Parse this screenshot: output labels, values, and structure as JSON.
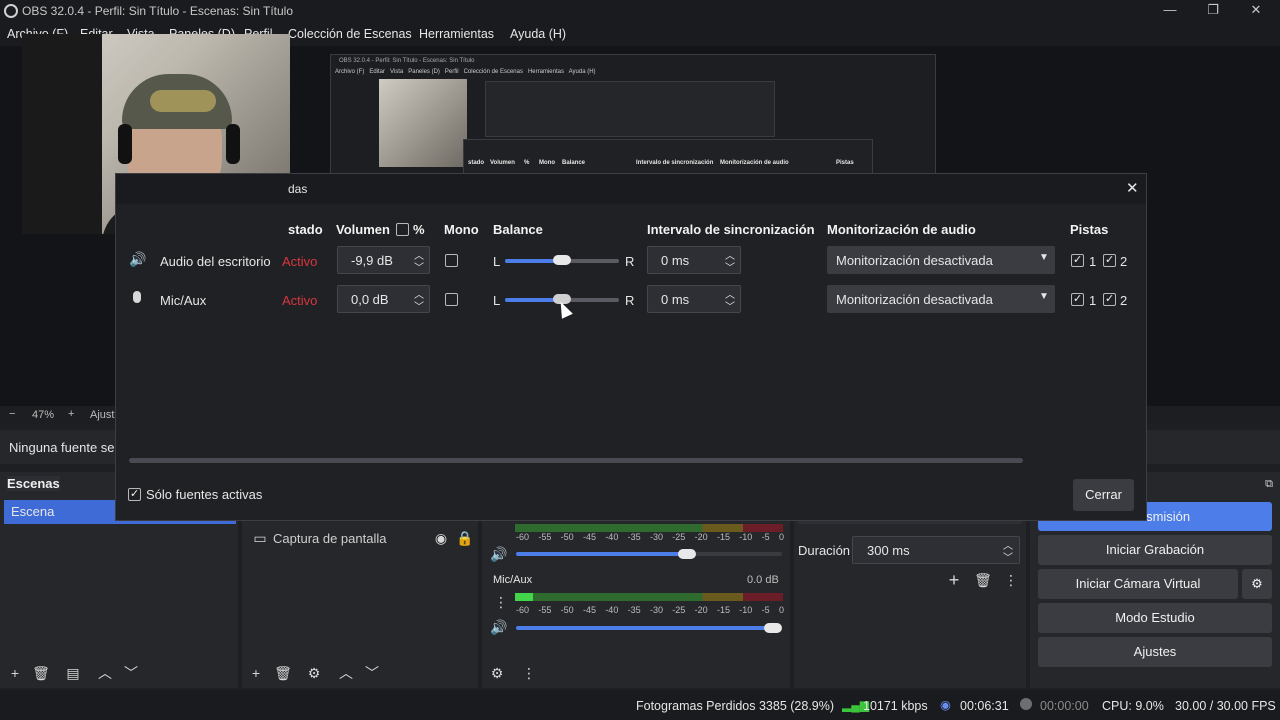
{
  "window": {
    "title": "OBS 32.0.4 - Perfil: Sin Título - Escenas: Sin Título"
  },
  "menu": [
    "Archivo (F)",
    "Editar",
    "Vista",
    "Paneles (D)",
    "Perfil",
    "Colección de Escenas",
    "Herramientas",
    "Ayuda (H)"
  ],
  "preview": {
    "zoom_minus": "−",
    "zoom_value": "47%",
    "zoom_plus": "+",
    "zoom_fit": "Ajust",
    "nested_title": "OBS 32.0.4 - Perfil: Sin Título - Escenas: Sin Título",
    "nested_menu": "Archivo (F)   Editar   Vista   Paneles (D)   Perfil   Colección de Escenas   Herramientas   Ayuda (H)",
    "nested_cols": [
      "stado",
      "Volumen",
      "%",
      "Mono",
      "Balance",
      "Intervalo de sincronización",
      "Monitorización de audio",
      "Pistas"
    ]
  },
  "source_bar": {
    "text": "Ninguna fuente sel"
  },
  "dialog": {
    "title": "das",
    "headers": {
      "estado": "stado",
      "volumen": "Volumen",
      "percent": "%",
      "mono": "Mono",
      "balance": "Balance",
      "sync": "Intervalo de sincronización",
      "monitor": "Monitorización de audio",
      "tracks": "Pistas"
    },
    "rows": [
      {
        "icon": "speaker-icon",
        "name": "Audio del escritorio",
        "status": "Activo",
        "volume": "-9,9 dB",
        "mono": false,
        "bal_l": "L",
        "bal_r": "R",
        "balance": 0.5,
        "sync": "0 ms",
        "monitor": "Monitorización desactivada",
        "t1": "1",
        "t2": "2"
      },
      {
        "icon": "mic-icon",
        "name": "Mic/Aux",
        "status": "Activo",
        "volume": "0,0 dB",
        "mono": false,
        "bal_l": "L",
        "bal_r": "R",
        "balance": 0.5,
        "sync": "0 ms",
        "monitor": "Monitorización desactivada",
        "t1": "1",
        "t2": "2"
      }
    ],
    "only_active_label": "Sólo fuentes activas",
    "close_label": "Cerrar"
  },
  "scenes": {
    "title": "Escenas",
    "items": [
      "Escena"
    ]
  },
  "sources": {
    "items": [
      "Captura de pantalla"
    ]
  },
  "mixer": {
    "scale": [
      "-60",
      "-55",
      "-50",
      "-45",
      "-40",
      "-35",
      "-30",
      "-25",
      "-20",
      "-15",
      "-10",
      "-5",
      "0"
    ],
    "channels": [
      {
        "name": "Mic/Aux",
        "db": "0.0 dB"
      }
    ]
  },
  "transitions": {
    "duration_label": "Duración",
    "duration_value": "300 ms"
  },
  "controls": {
    "stream": "Transmisión",
    "record": "Iniciar Grabación",
    "vcam": "Iniciar Cámara Virtual",
    "studio": "Modo Estudio",
    "settings": "Ajustes"
  },
  "status": {
    "dropped": "Fotogramas Perdidos 3385 (28.9%)",
    "bitrate": "10171 kbps",
    "stream_time": "00:06:31",
    "rec_time": "00:00:00",
    "cpu": "CPU: 9.0%",
    "fps": "30.00 / 30.00 FPS"
  },
  "colors": {
    "accent": "#4c7de8",
    "active_red": "#d9363e",
    "dialog_bg": "#202124"
  }
}
